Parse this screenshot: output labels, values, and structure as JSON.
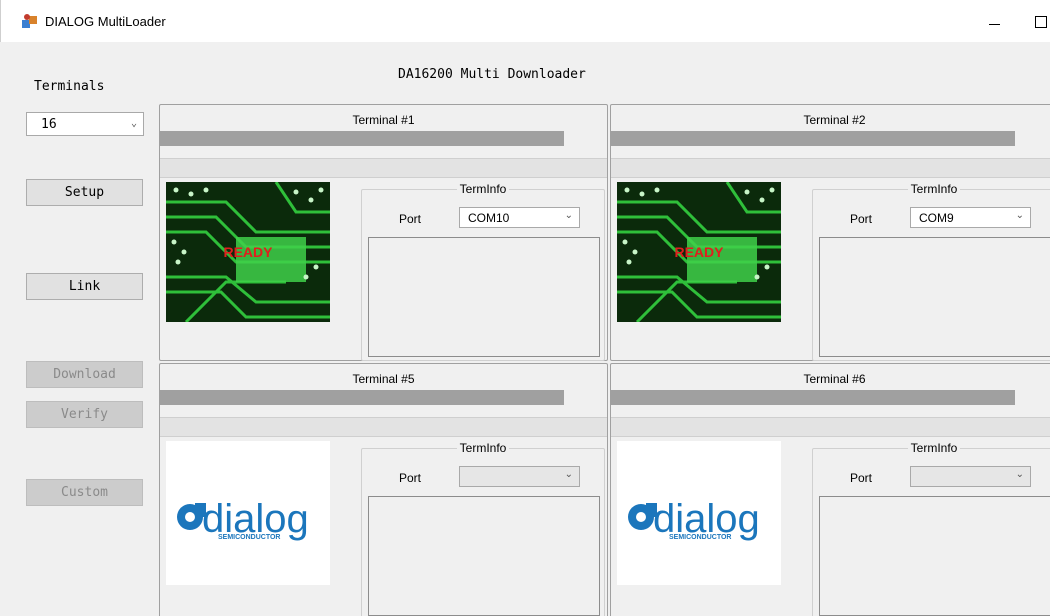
{
  "window": {
    "title": "DIALOG MultiLoader",
    "icon": "app-icon",
    "controls": [
      "minimize-icon",
      "maximize-icon"
    ]
  },
  "header": {
    "app_title": "DA16200 Multi Downloader"
  },
  "sidebar": {
    "terminals_label": "Terminals",
    "terminals_value": "16",
    "buttons": {
      "setup": "Setup",
      "link": "Link",
      "download": "Download",
      "verify": "Verify",
      "custom": "Custom"
    }
  },
  "terminals": [
    {
      "title": "Terminal #1",
      "status_image": "pcb-ready",
      "status_text": "READY",
      "group": "TermInfo",
      "port_label": "Port",
      "port_value": "COM10"
    },
    {
      "title": "Terminal #2",
      "status_image": "pcb-ready",
      "status_text": "READY",
      "group": "TermInfo",
      "port_label": "Port",
      "port_value": "COM9"
    },
    {
      "title": "Terminal #5",
      "status_image": "dialog-logo",
      "logo_text": "dialog",
      "logo_subtext": "SEMICONDUCTOR",
      "group": "TermInfo",
      "port_label": "Port",
      "port_value": ""
    },
    {
      "title": "Terminal #6",
      "status_image": "dialog-logo",
      "logo_text": "dialog",
      "logo_subtext": "SEMICONDUCTOR",
      "group": "TermInfo",
      "port_label": "Port",
      "port_value": ""
    }
  ],
  "colors": {
    "progress": "#a0a0a0",
    "ready_text": "#e01e1e",
    "pcb_green": "#1f9a2a",
    "logo_blue": "#1b76bc"
  }
}
